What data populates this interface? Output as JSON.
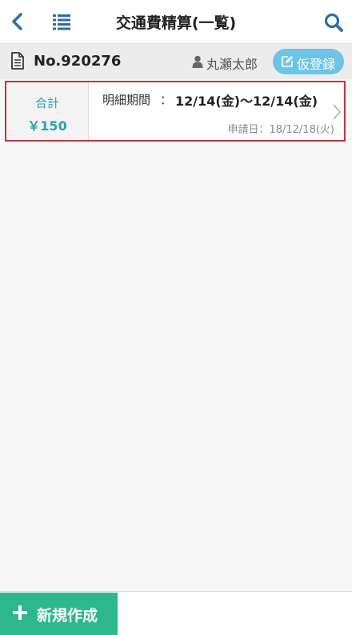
{
  "header": {
    "title": "交通費精算(一覧)",
    "icons": {
      "back": "chevron-left-icon",
      "menu": "list-icon",
      "search": "search-icon"
    }
  },
  "subheader": {
    "doc_number": "No.920276",
    "user_name": "丸瀬太郎",
    "draft_button_label": "仮登録",
    "icons": {
      "document": "document-icon",
      "user": "user-icon",
      "edit": "edit-icon"
    }
  },
  "entries": [
    {
      "total_label": "合計",
      "total_amount": "￥150",
      "period_label": "明細期間",
      "period_separator": "：",
      "period_value": "12/14(金)〜12/14(金)",
      "apply_date": "申請日：18/12/18(火)"
    }
  ],
  "footer": {
    "new_button_label": "新規作成",
    "icon": "plus-icon"
  },
  "colors": {
    "accent": "#2ba0b3",
    "header_icon": "#2c6da6",
    "draft_button": "#6cc5e8",
    "new_button": "#2db88c",
    "selection_border": "#c8323c"
  }
}
